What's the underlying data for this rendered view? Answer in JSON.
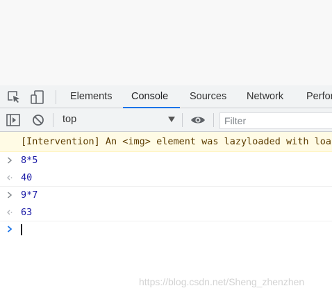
{
  "devtools": {
    "tabs": [
      {
        "label": "Elements"
      },
      {
        "label": "Console"
      },
      {
        "label": "Sources"
      },
      {
        "label": "Network"
      },
      {
        "label": "Perfor"
      }
    ],
    "active_tab": "Console",
    "icons": [
      "inspect-element-icon",
      "device-toolbar-icon"
    ]
  },
  "console_toolbar": {
    "icons": [
      "sidebar-toggle-icon",
      "clear-console-icon",
      "eye-icon"
    ],
    "context": "top",
    "filter_placeholder": "Filter"
  },
  "console": {
    "warning": "[Intervention] An <img> element was lazyloaded with loa",
    "entries": [
      {
        "type": "input",
        "text": "8*5"
      },
      {
        "type": "output",
        "text": "40"
      },
      {
        "type": "input",
        "text": "9*7"
      },
      {
        "type": "output",
        "text": "63"
      }
    ]
  },
  "colors": {
    "accent": "#1a73e8",
    "prompt_blue": "#1a73e8",
    "value_blue": "#1a1aa6",
    "warning_bg": "#fffbe5",
    "warning_text": "#5c3c00"
  },
  "watermark": "https://blog.csdn.net/Sheng_zhenzhen"
}
